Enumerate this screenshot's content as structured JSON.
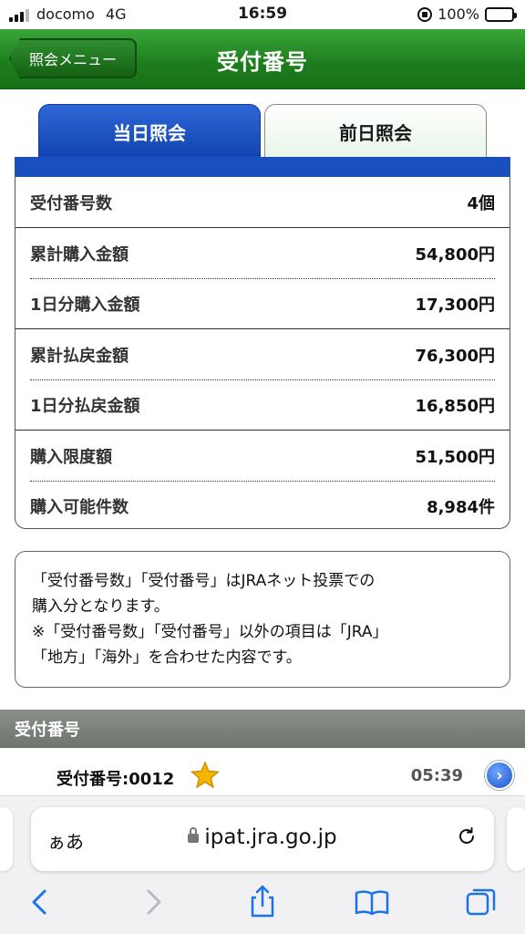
{
  "status_bar": {
    "carrier": "docomo",
    "network": "4G",
    "time": "16:59",
    "battery": "100%"
  },
  "header": {
    "back_label": "照会メニュー",
    "title": "受付番号"
  },
  "tabs": [
    {
      "label": "当日照会",
      "active": true
    },
    {
      "label": "前日照会",
      "active": false
    }
  ],
  "summary": {
    "rows": [
      {
        "label": "受付番号数",
        "value": "4個"
      },
      {
        "label": "累計購入金額",
        "value": "54,800円"
      },
      {
        "label": "1日分購入金額",
        "value": "17,300円"
      },
      {
        "label": "累計払戻金額",
        "value": "76,300円"
      },
      {
        "label": "1日分払戻金額",
        "value": "16,850円"
      },
      {
        "label": "購入限度額",
        "value": "51,500円"
      },
      {
        "label": "購入可能件数",
        "value": "8,984件"
      }
    ]
  },
  "note": {
    "line1": "「受付番号数」「受付番号」はJRAネット投票での",
    "line2": "購入分となります。",
    "line3": "※「受付番号数」「受付番号」以外の項目は「JRA」",
    "line4": "「地方」「海外」を合わせた内容です。"
  },
  "section": {
    "title": "受付番号"
  },
  "receipts": [
    {
      "number": "受付番号:0012",
      "time": "05:39",
      "icon": "star-icon"
    }
  ],
  "browser": {
    "aa_label": "ぁあ",
    "url": "ipat.jra.go.jp"
  },
  "colors": {
    "header_green": "#1e7f1e",
    "tab_blue": "#1a4fc0",
    "star": "#f5b400"
  }
}
